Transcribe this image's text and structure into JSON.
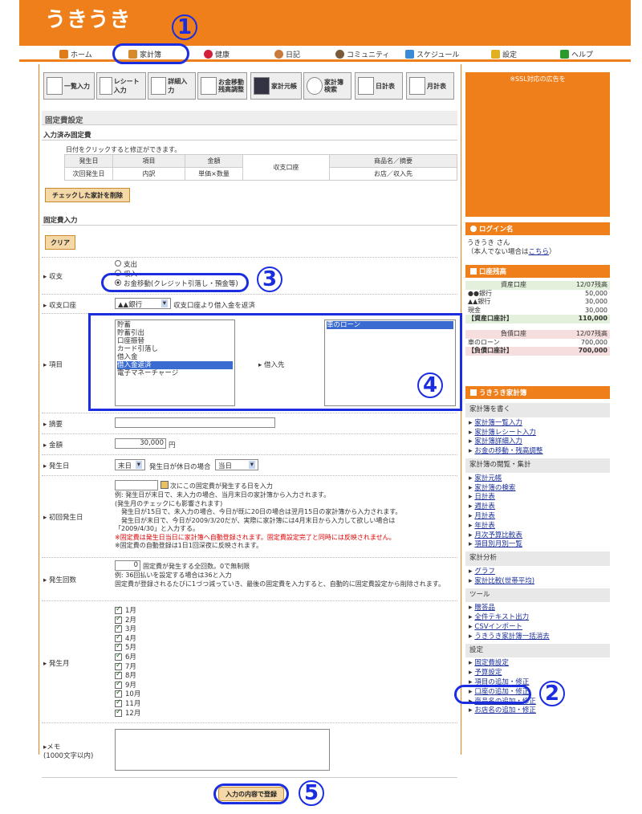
{
  "header": {
    "logo": "うきうき"
  },
  "nav": [
    {
      "label": "ホーム",
      "color": "#e07b1a"
    },
    {
      "label": "家計簿",
      "color": "#d58a2c"
    },
    {
      "label": "健康",
      "color": "#d21f3a"
    },
    {
      "label": "日記",
      "color": "#c97a3a"
    },
    {
      "label": "コミュニティ",
      "color": "#7a5a3a"
    },
    {
      "label": "スケジュール",
      "color": "#3a8ad6"
    },
    {
      "label": "設定",
      "color": "#e0b020"
    },
    {
      "label": "ヘルプ",
      "color": "#2a9a2a"
    }
  ],
  "toolbar": [
    {
      "label": "一覧入力"
    },
    {
      "label": "レシート入力"
    },
    {
      "label": "詳細入力"
    },
    {
      "label": "お金移動\n残高調整"
    },
    {
      "label": "家計元帳"
    },
    {
      "label": "家計簿\n検索"
    },
    {
      "label": "日計表"
    },
    {
      "label": "月計表"
    }
  ],
  "main": {
    "title": "固定費設定",
    "entered_heading": "入力済み固定費",
    "click_note": "日付をクリックすると修正ができます。",
    "table": {
      "r1": [
        "発生日",
        "項目",
        "金額",
        "収支口座",
        "商品名／摘要"
      ],
      "r2": [
        "次回発生日",
        "内訳",
        "単価×数量",
        "お店／収入先"
      ]
    },
    "delete_button": "チェックした家計を削除",
    "input_heading": "固定費入力",
    "clear_button": "クリア",
    "balance_label": "収支",
    "balance_options": [
      "支出",
      "収入",
      "お金移動(クレジット引落し・預金等)"
    ],
    "account_label": "収支口座",
    "account_value": "▲▲銀行",
    "account_note": "収支口座より借入金を返済",
    "item_label": "項目",
    "item_options": [
      "貯蓄",
      "貯蓄引出",
      "口座振替",
      "カード引落し",
      "借入金",
      "借入金返済",
      "電子マネーチャージ"
    ],
    "item_selected": "借入金返済",
    "borrow_label": "借入先",
    "borrow_options": [
      "車のローン"
    ],
    "memo_label": "摘要",
    "amount_label": "金額",
    "amount_value": "30,000",
    "amount_unit": "円",
    "date_label": "発生日",
    "date_value": "末日",
    "holiday_note": "発生日が休日の場合",
    "holiday_value": "当日",
    "first_label": "初回発生日",
    "first_note": "次にこの固定費が発生する日を入力",
    "first_lines": [
      "例: 発生日が末日で、未入力の場合、当月末日の家計簿から入力されます。",
      "(発生月のチェックにも影響されます)",
      "　発生日が15日で、未入力の場合、今日が既に20日の場合は翌月15日の家計簿から入力されます。",
      "　発生日が末日で、今日が2009/3/20だが、実際に家計簿には4月末日から入力して欲しい場合は",
      "「2009/4/30」と入力する。"
    ],
    "first_red": "※固定費は発生日当日に家計簿へ自動登録されます。固定費設定完了と同時には反映されません。",
    "first_last": "※固定費の自動登録は1日1回深夜に反映されます。",
    "count_label": "発生回数",
    "count_value": "0",
    "count_note": "固定費が発生する全回数。0で無制限",
    "count_lines": [
      "例: 36回払いを設定する場合は36と入力",
      "固定費が登録されるたびに1づつ減っていき、最後の固定費を入力すると、自動的に固定費設定から削除されます。"
    ],
    "month_label": "発生月",
    "months": [
      "1月",
      "2月",
      "3月",
      "4月",
      "5月",
      "6月",
      "7月",
      "8月",
      "9月",
      "10月",
      "11月",
      "12月"
    ],
    "note_label": "メモ",
    "note_sub": "(1000文字以内)",
    "submit_button": "入力の内容で登録"
  },
  "sidebar": {
    "ad_text": "※SSL対応の広告を",
    "login_title": "ログイン名",
    "login_name": "うきうき さん",
    "login_note_pre": "（本人でない場合は",
    "login_link": "こちら",
    "login_note_post": "）",
    "balance_title": "口座残高",
    "asset_head": [
      "資産口座",
      "12/07残高"
    ],
    "assets": [
      [
        "●●銀行",
        "50,000"
      ],
      [
        "▲▲銀行",
        "30,000"
      ],
      [
        "現金",
        "30,000"
      ]
    ],
    "asset_total": [
      "【資産口座計】",
      "110,000"
    ],
    "debt_head": [
      "負債口座",
      "12/07残高"
    ],
    "debts": [
      [
        "車のローン",
        "700,000"
      ]
    ],
    "debt_total": [
      "【負債口座計】",
      "700,000"
    ],
    "menu_title": "うきうき家計簿",
    "groups": [
      {
        "title": "家計簿を書く",
        "items": [
          "家計簿一覧入力",
          "家計簿レシート入力",
          "家計簿詳細入力",
          "お金の移動・残高調整"
        ]
      },
      {
        "title": "家計簿の閲覧・集計",
        "items": [
          "家計元帳",
          "家計簿の検索",
          "日計表",
          "週計表",
          "月計表",
          "年計表",
          "月次予算比較表",
          "項目別月別一覧"
        ]
      },
      {
        "title": "家計分析",
        "items": [
          "グラフ",
          "家計比較(世帯平均)"
        ]
      },
      {
        "title": "ツール",
        "items": [
          "贈答品",
          "全件テキスト出力",
          "CSVインポート",
          "うきうき家計簿一括消去"
        ]
      },
      {
        "title": "設定",
        "items": [
          "固定費設定",
          "予算設定",
          "項目の追加・修正",
          "口座の追加・修正",
          "商品名の追加・修正",
          "お店名の追加・修正"
        ]
      }
    ]
  },
  "callouts": [
    "1",
    "2",
    "3",
    "4",
    "5"
  ]
}
